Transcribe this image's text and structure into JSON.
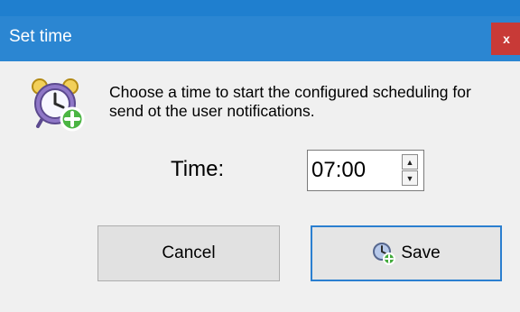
{
  "window": {
    "title": "Set time",
    "close_label": "x"
  },
  "dialog": {
    "message": "Choose a time to start the configured scheduling for send ot the user notifications.",
    "time_label": "Time:",
    "time_value": "07:00"
  },
  "buttons": {
    "cancel_label": "Cancel",
    "save_label": "Save"
  },
  "colors": {
    "titlebar": "#2b86d2",
    "close": "#c83a37",
    "focus_border": "#2b7fd0"
  },
  "icons": {
    "dialog_icon": "alarm-clock-add-icon",
    "save_icon": "clock-add-icon",
    "spin_up": "up-arrow-icon",
    "spin_down": "down-arrow-icon"
  }
}
